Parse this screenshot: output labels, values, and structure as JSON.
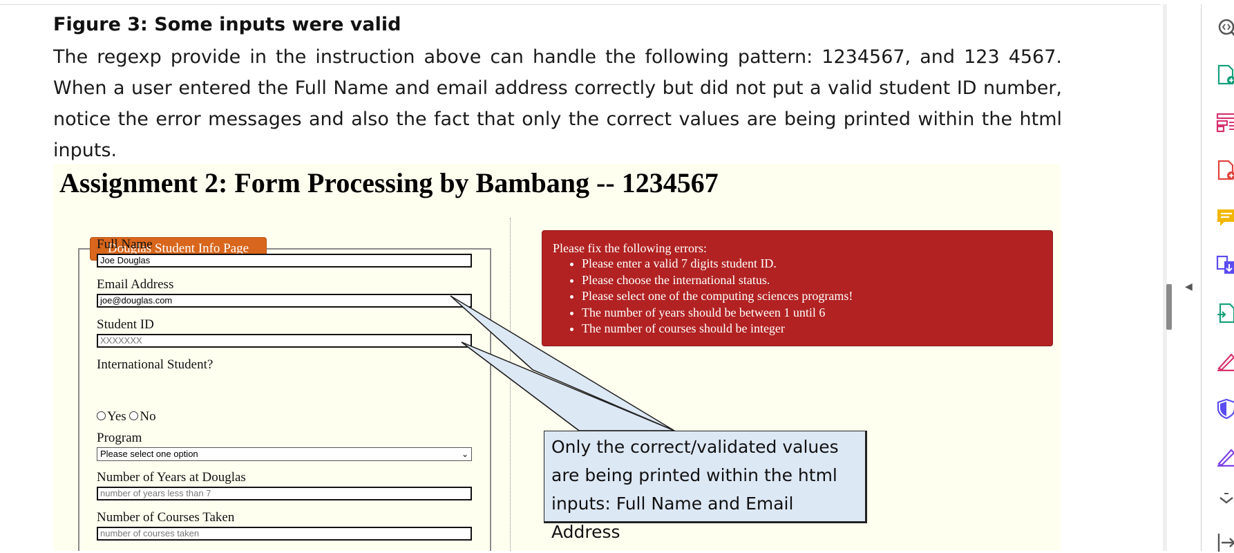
{
  "document": {
    "figure_title": "Figure 3: Some inputs were valid",
    "paragraph": "The regexp provide in the instruction above can handle the following pattern: 1234567, and 123 4567. When a user entered the Full Name and email address correctly but did not put a valid student ID number, notice the error messages and also the fact that only the correct values are being printed within the html inputs."
  },
  "app": {
    "title": "Assignment 2: Form Processing by Bambang -- 1234567",
    "legend": "Douglas Student Info Page",
    "fields": {
      "full_name_label": "Full Name",
      "full_name_value": "Joe Douglas",
      "email_label": "Email Address",
      "email_value": "joe@douglas.com",
      "student_id_label": "Student ID",
      "student_id_placeholder": "XXXXXXX",
      "international_label": "International Student?",
      "yes_label": "Yes",
      "no_label": "No",
      "program_label": "Program",
      "program_selected": "Please select one option",
      "years_label": "Number of Years at Douglas",
      "years_placeholder": "number of years less than 7",
      "courses_label": "Number of Courses Taken",
      "courses_placeholder": "number of courses taken"
    },
    "errors": {
      "heading": "Please fix the following errors:",
      "items": [
        "Please enter a valid 7 digits student ID.",
        "Please choose the international status.",
        "Please select one of the computing sciences programs!",
        "The number of years should be between 1 until 6",
        "The number of courses should be integer"
      ]
    }
  },
  "callout": {
    "text": "Only the correct/validated values are being printed within the html inputs: Full Name and Email Address",
    "fill_color": "#dde8f5"
  },
  "toolbar": {
    "icons": [
      "zoom-icon",
      "export-pdf-icon",
      "organize-pages-icon",
      "create-pdf-icon",
      "comment-icon",
      "combine-files-icon",
      "share-icon",
      "fill-sign-icon",
      "protect-icon",
      "edit-icon",
      "more-tools-icon",
      "exit-icon"
    ]
  },
  "colors": {
    "error_background": "#b22222",
    "legend_background": "#d8661c",
    "form_background": "#fffff0"
  }
}
